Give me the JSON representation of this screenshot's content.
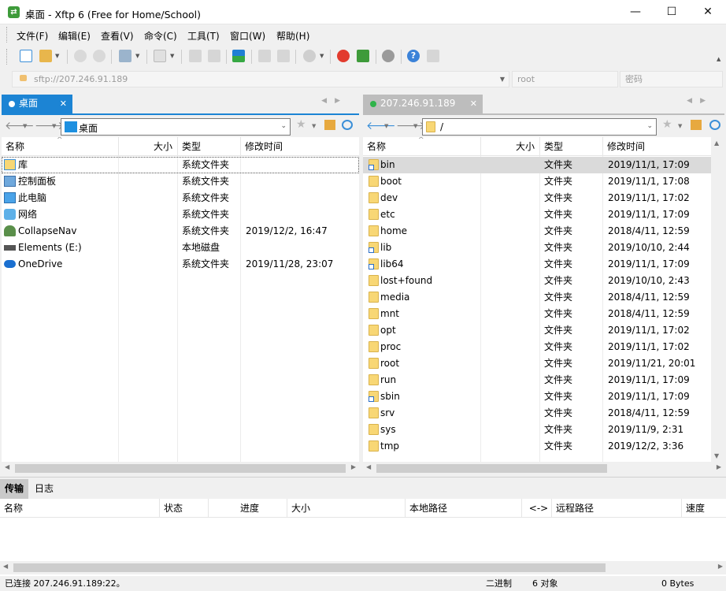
{
  "window": {
    "title": "桌面 - Xftp 6 (Free for Home/School)",
    "minimize": "—",
    "maximize": "☐",
    "close": "✕"
  },
  "menu": [
    "文件(F)",
    "编辑(E)",
    "查看(V)",
    "命令(C)",
    "工具(T)",
    "窗口(W)",
    "帮助(H)"
  ],
  "address": {
    "url_placeholder": "sftp://207.246.91.189",
    "user_placeholder": "root",
    "password_placeholder": "密码"
  },
  "left_pane": {
    "tab_label": "桌面",
    "path": "桌面",
    "columns": [
      "名称",
      "大小",
      "类型",
      "修改时间"
    ],
    "rows": [
      {
        "name": "库",
        "size": "",
        "type": "系统文件夹",
        "modified": "",
        "icon": "library-icon"
      },
      {
        "name": "控制面板",
        "size": "",
        "type": "系统文件夹",
        "modified": "",
        "icon": "control-panel-icon"
      },
      {
        "name": "此电脑",
        "size": "",
        "type": "系统文件夹",
        "modified": "",
        "icon": "computer-icon"
      },
      {
        "name": "网络",
        "size": "",
        "type": "系统文件夹",
        "modified": "",
        "icon": "network-icon"
      },
      {
        "name": "CollapseNav",
        "size": "",
        "type": "系统文件夹",
        "modified": "2019/12/2, 16:47",
        "icon": "user-icon"
      },
      {
        "name": "Elements (E:)",
        "size": "",
        "type": "本地磁盘",
        "modified": "",
        "icon": "drive-icon"
      },
      {
        "name": "OneDrive",
        "size": "",
        "type": "系统文件夹",
        "modified": "2019/11/28, 23:07",
        "icon": "cloud-icon"
      }
    ]
  },
  "right_pane": {
    "tab_label": "207.246.91.189",
    "path": "/",
    "columns": [
      "名称",
      "大小",
      "类型",
      "修改时间"
    ],
    "rows": [
      {
        "name": "bin",
        "type": "文件夹",
        "modified": "2019/11/1, 17:09",
        "link": true
      },
      {
        "name": "boot",
        "type": "文件夹",
        "modified": "2019/11/1, 17:08",
        "link": false
      },
      {
        "name": "dev",
        "type": "文件夹",
        "modified": "2019/11/1, 17:02",
        "link": false
      },
      {
        "name": "etc",
        "type": "文件夹",
        "modified": "2019/11/1, 17:09",
        "link": false
      },
      {
        "name": "home",
        "type": "文件夹",
        "modified": "2018/4/11, 12:59",
        "link": false
      },
      {
        "name": "lib",
        "type": "文件夹",
        "modified": "2019/10/10, 2:44",
        "link": true
      },
      {
        "name": "lib64",
        "type": "文件夹",
        "modified": "2019/11/1, 17:09",
        "link": true
      },
      {
        "name": "lost+found",
        "type": "文件夹",
        "modified": "2019/10/10, 2:43",
        "link": false
      },
      {
        "name": "media",
        "type": "文件夹",
        "modified": "2018/4/11, 12:59",
        "link": false
      },
      {
        "name": "mnt",
        "type": "文件夹",
        "modified": "2018/4/11, 12:59",
        "link": false
      },
      {
        "name": "opt",
        "type": "文件夹",
        "modified": "2019/11/1, 17:02",
        "link": false
      },
      {
        "name": "proc",
        "type": "文件夹",
        "modified": "2019/11/1, 17:02",
        "link": false
      },
      {
        "name": "root",
        "type": "文件夹",
        "modified": "2019/11/21, 20:01",
        "link": false
      },
      {
        "name": "run",
        "type": "文件夹",
        "modified": "2019/11/1, 17:09",
        "link": false
      },
      {
        "name": "sbin",
        "type": "文件夹",
        "modified": "2019/11/1, 17:09",
        "link": true
      },
      {
        "name": "srv",
        "type": "文件夹",
        "modified": "2018/4/11, 12:59",
        "link": false
      },
      {
        "name": "sys",
        "type": "文件夹",
        "modified": "2019/11/9, 2:31",
        "link": false
      },
      {
        "name": "tmp",
        "type": "文件夹",
        "modified": "2019/12/2, 3:36",
        "link": false
      }
    ]
  },
  "transfer": {
    "tabs": [
      "传输",
      "日志"
    ],
    "columns": [
      "名称",
      "状态",
      "进度",
      "大小",
      "本地路径",
      "<->",
      "远程路径",
      "速度"
    ]
  },
  "status": {
    "connection": "已连接 207.246.91.189:22。",
    "mode": "二进制",
    "objects": "6 对象",
    "bytes": "0 Bytes"
  },
  "colors": {
    "accent": "#1c84d4",
    "folder": "#f8d775",
    "connected": "#2fb34a"
  }
}
